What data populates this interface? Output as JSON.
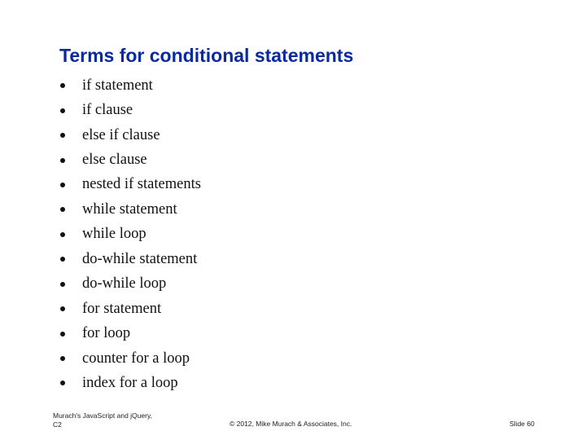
{
  "slide": {
    "title": "Terms for conditional statements",
    "terms": [
      "if statement",
      "if clause",
      "else if clause",
      "else clause",
      "nested if statements",
      "while statement",
      "while loop",
      "do-while statement",
      "do-while loop",
      "for statement",
      "for loop",
      "counter for a loop",
      "index for a loop"
    ]
  },
  "footer": {
    "book_line1": "Murach's JavaScript and jQuery,",
    "book_line2": "C2",
    "copyright": "© 2012, Mike Murach & Associates, Inc.",
    "slide_number": "Slide 60"
  },
  "colors": {
    "title": "#0a2a9e"
  }
}
